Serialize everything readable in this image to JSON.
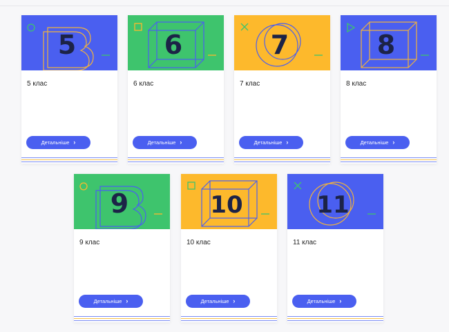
{
  "button_label": "Детальніше",
  "colors": {
    "blue": "#4a5ff0",
    "green": "#3ec46d",
    "yellow": "#fdb92c",
    "navy": "#1c2347",
    "button": "#4a5ff0"
  },
  "cards": [
    {
      "number": "5",
      "title": "5 клас",
      "bg": "blue",
      "shape": "b-letter"
    },
    {
      "number": "6",
      "title": "6 клас",
      "bg": "green",
      "shape": "cube"
    },
    {
      "number": "7",
      "title": "7 клас",
      "bg": "yellow",
      "shape": "circles"
    },
    {
      "number": "8",
      "title": "8 клас",
      "bg": "blue",
      "shape": "cube"
    },
    {
      "number": "9",
      "title": "9 клас",
      "bg": "green",
      "shape": "b-letter"
    },
    {
      "number": "10",
      "title": "10 клас",
      "bg": "yellow",
      "shape": "cube"
    },
    {
      "number": "11",
      "title": "11 клас",
      "bg": "blue",
      "shape": "circles"
    }
  ]
}
